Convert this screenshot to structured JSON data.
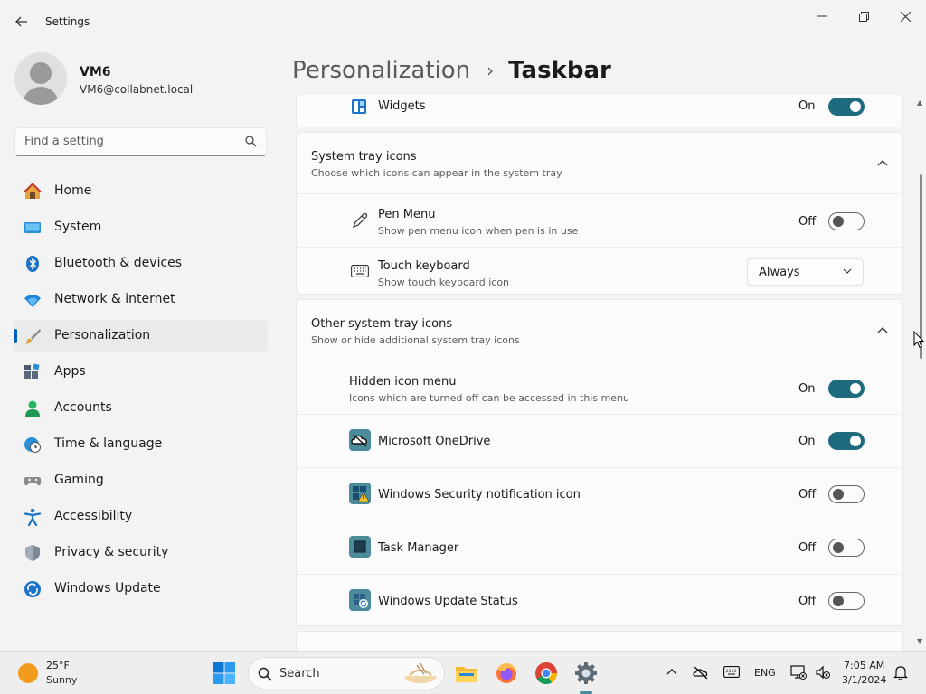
{
  "window": {
    "title": "Settings",
    "back_icon": "arrow-left-icon"
  },
  "user": {
    "name": "VM6",
    "email": "VM6@collabnet.local"
  },
  "search": {
    "placeholder": "Find a setting"
  },
  "nav": [
    {
      "label": "Home",
      "icon": "home-icon",
      "active": false
    },
    {
      "label": "System",
      "icon": "system-icon",
      "active": false
    },
    {
      "label": "Bluetooth & devices",
      "icon": "bluetooth-icon",
      "active": false
    },
    {
      "label": "Network & internet",
      "icon": "wifi-icon",
      "active": false
    },
    {
      "label": "Personalization",
      "icon": "brush-icon",
      "active": true
    },
    {
      "label": "Apps",
      "icon": "apps-icon",
      "active": false
    },
    {
      "label": "Accounts",
      "icon": "accounts-icon",
      "active": false
    },
    {
      "label": "Time & language",
      "icon": "globe-clock-icon",
      "active": false
    },
    {
      "label": "Gaming",
      "icon": "gamepad-icon",
      "active": false
    },
    {
      "label": "Accessibility",
      "icon": "accessibility-icon",
      "active": false
    },
    {
      "label": "Privacy & security",
      "icon": "shield-icon",
      "active": false
    },
    {
      "label": "Windows Update",
      "icon": "update-icon",
      "active": false
    }
  ],
  "breadcrumb": {
    "parent": "Personalization",
    "separator": "›",
    "current": "Taskbar"
  },
  "widgets": {
    "label": "Widgets",
    "state": "On"
  },
  "system_tray": {
    "title": "System tray icons",
    "description": "Choose which icons can appear in the system tray",
    "items": [
      {
        "title": "Pen Menu",
        "description": "Show pen menu icon when pen is in use",
        "state": "Off"
      },
      {
        "title": "Touch keyboard",
        "description": "Show touch keyboard icon",
        "selected": "Always"
      }
    ]
  },
  "other_tray": {
    "title": "Other system tray icons",
    "description": "Show or hide additional system tray icons",
    "hidden_menu": {
      "title": "Hidden icon menu",
      "description": "Icons which are turned off can be accessed in this menu",
      "state": "On"
    },
    "items": [
      {
        "title": "Microsoft OneDrive",
        "state": "On"
      },
      {
        "title": "Windows Security notification icon",
        "state": "Off"
      },
      {
        "title": "Task Manager",
        "state": "Off"
      },
      {
        "title": "Windows Update Status",
        "state": "Off"
      }
    ]
  },
  "taskbar": {
    "weather": {
      "temp": "25°F",
      "condition": "Sunny"
    },
    "search_label": "Search",
    "language": "ENG",
    "time": "7:05 AM",
    "date": "3/1/2024"
  },
  "colors": {
    "accent": "#1e6b7f",
    "nav_active_bar": "#005fb8",
    "app_icon": "#4c8b9a"
  }
}
